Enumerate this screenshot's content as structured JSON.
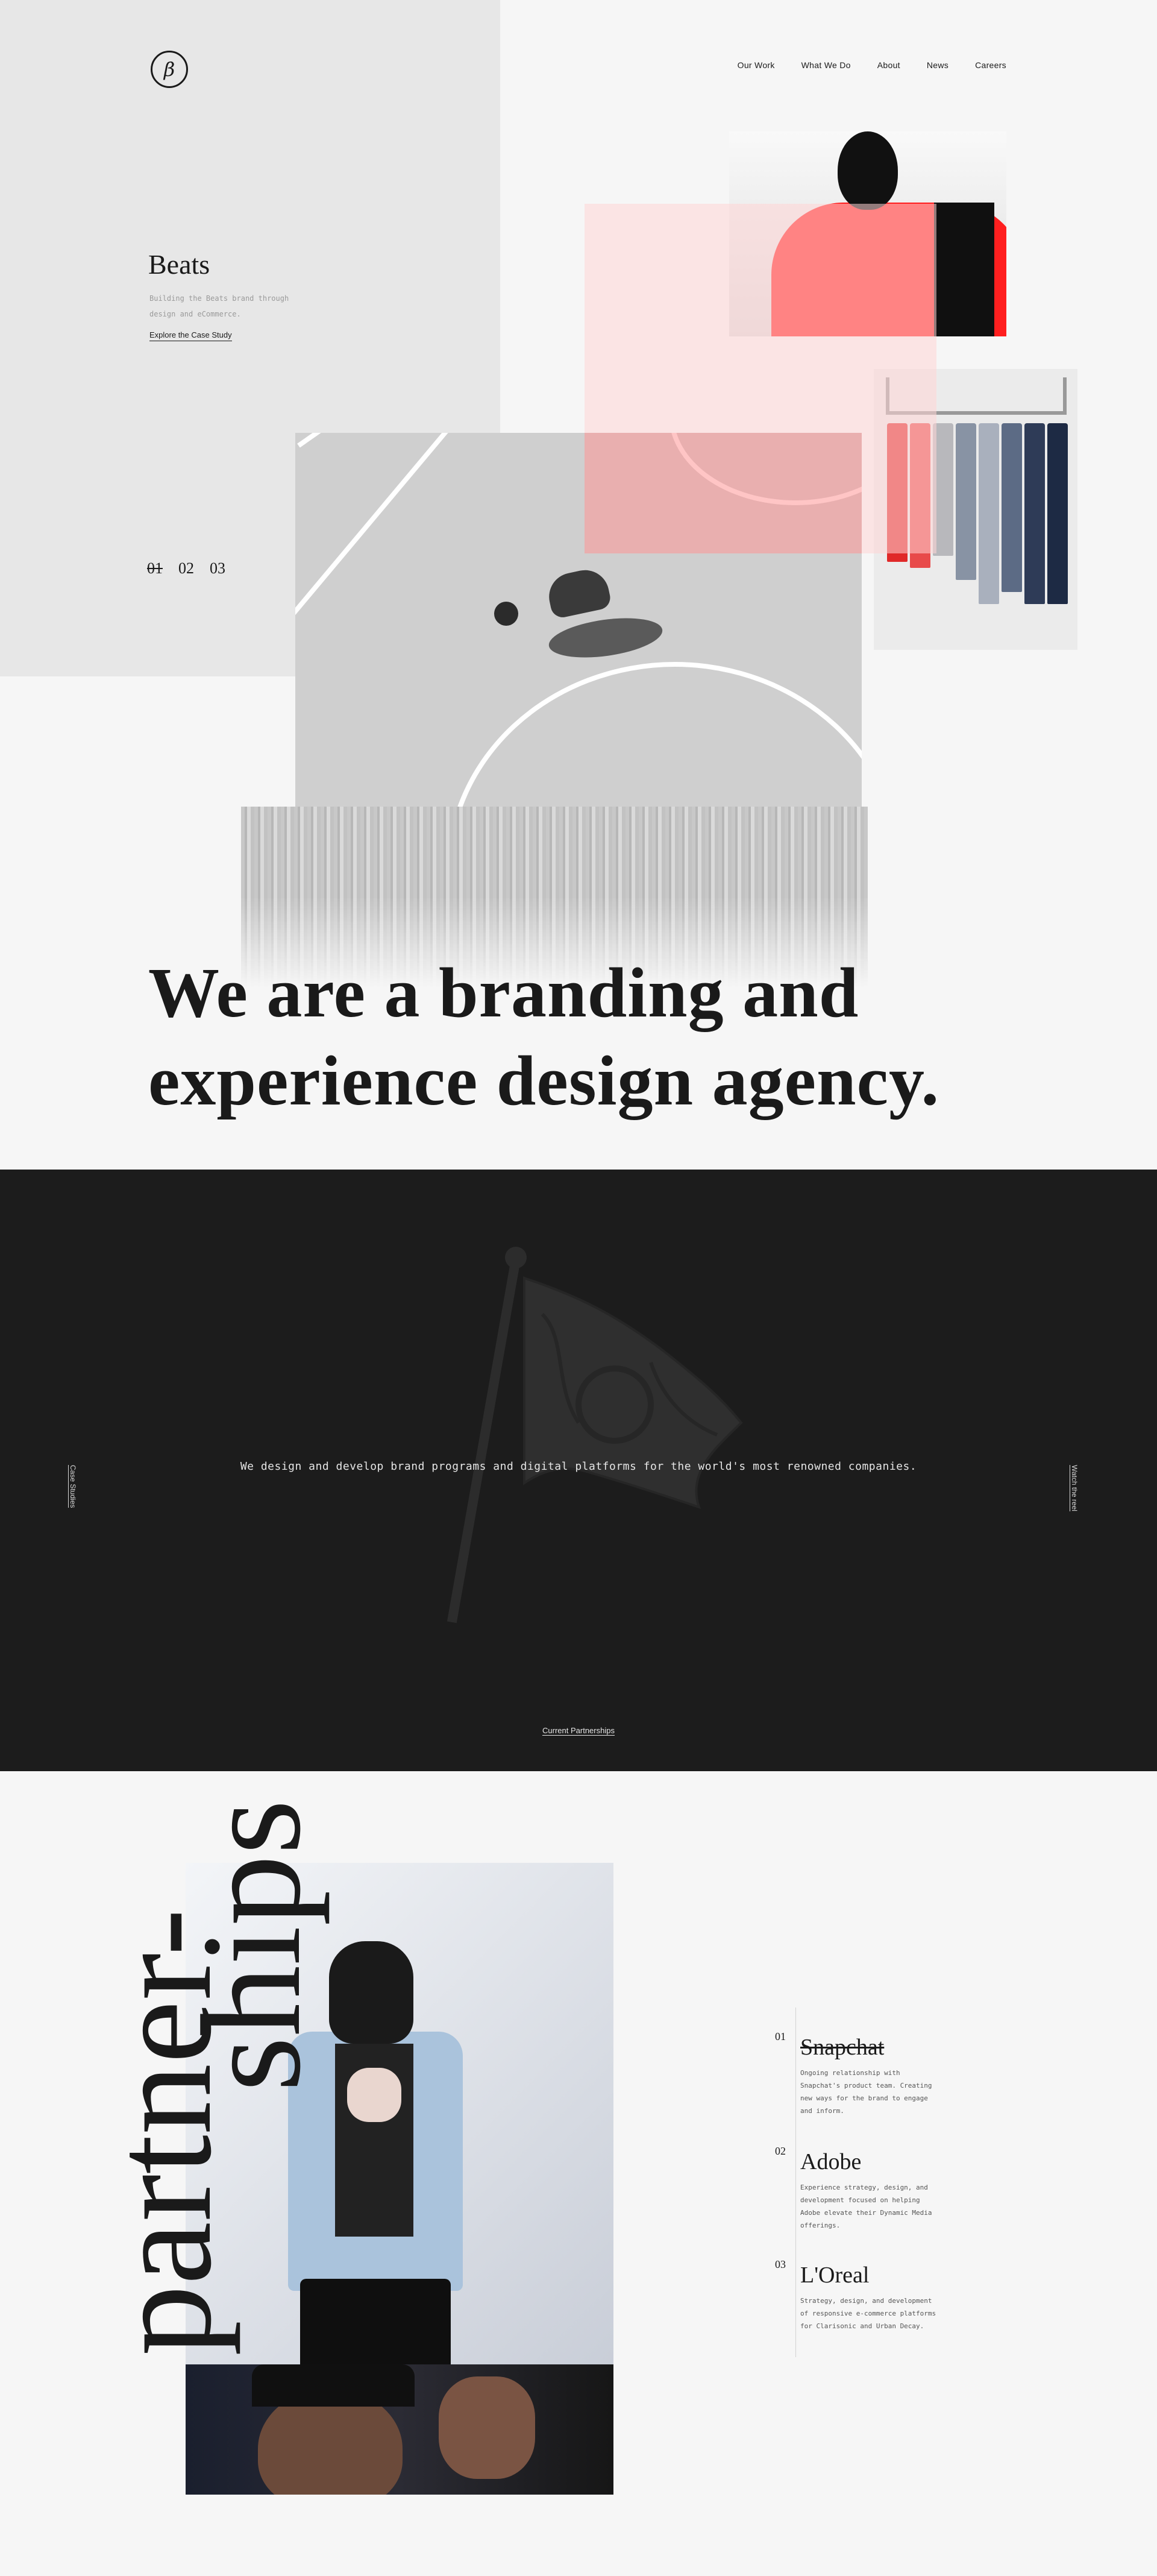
{
  "header": {
    "logo_glyph": "β",
    "nav": [
      "Our Work",
      "What We Do",
      "About",
      "News",
      "Careers"
    ]
  },
  "hero": {
    "case_title": "Beats",
    "case_description": "Building the Beats brand through design and eCommerce.",
    "case_link": "Explore the Case Study",
    "pager": [
      "01",
      "02",
      "03"
    ],
    "headline_line1": "We are a branding and",
    "headline_line2": "experience design agency."
  },
  "intro": {
    "left_link": "Case Studies",
    "right_link": "Watch the reel",
    "statement": "We design and develop brand programs and digital platforms for the world's most renowned companies.",
    "bottom_link": "Current Partnerships"
  },
  "partnerships": {
    "title_part1": "partner-",
    "title_part2": "ships",
    "items": [
      {
        "number": "01",
        "name": "Snapchat",
        "description": "Ongoing relationship with Snapchat's product team. Creating new ways for the brand to engage and inform."
      },
      {
        "number": "02",
        "name": "Adobe",
        "description": "Experience strategy, design, and development focused on helping Adobe elevate their Dynamic Media offerings."
      },
      {
        "number": "03",
        "name": "L'Oreal",
        "description": "Strategy, design, and development of responsive e-commerce platforms for Clarisonic and Urban Decay."
      }
    ]
  },
  "colors": {
    "background": "#f6f6f6",
    "hero_panel": "#e7e7e7",
    "dark_section": "#1c1c1c",
    "accent_red": "#ff1f1f",
    "text": "#1a1a1a"
  },
  "icons": [
    "brand-logo-icon",
    "flag-illustration-icon"
  ]
}
